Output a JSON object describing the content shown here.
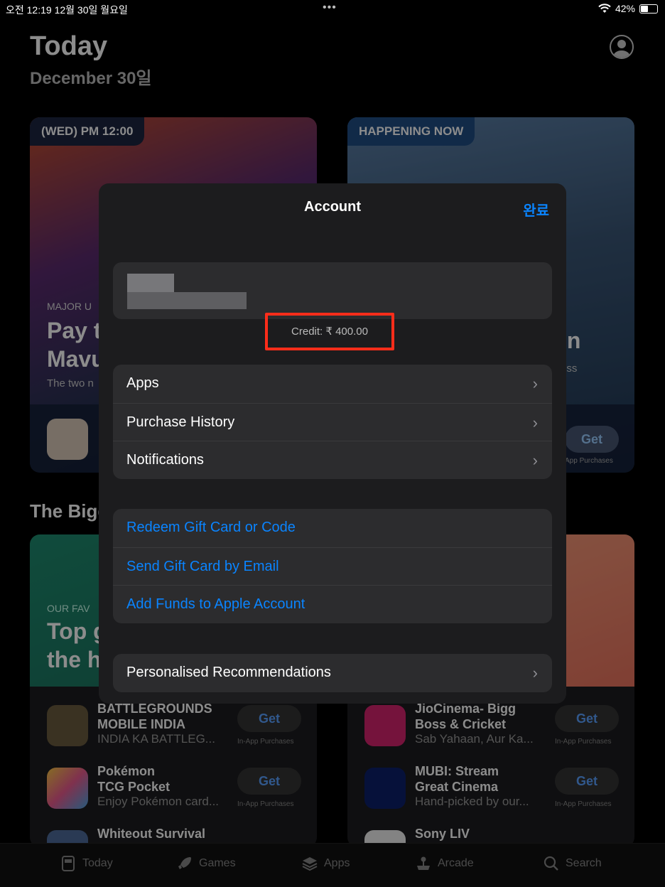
{
  "status_bar": {
    "time_date": "오전 12:19   12월 30일 월요일",
    "dots": "•••",
    "battery": "42%"
  },
  "background": {
    "title": "Today",
    "date": "December 30일",
    "card1": {
      "tag": "(WED) PM 12:00",
      "sub": "MAJOR U",
      "big_line1": "Pay t",
      "big_line2": "Mavu",
      "desc": "The two n"
    },
    "card2": {
      "tag": "HAPPENING NOW",
      "big_right": "in",
      "sub_right": "ess",
      "get": "Get",
      "iap": "App Purchases"
    },
    "section_title": "The Bigg",
    "card3": {
      "sub": "OUR FAV",
      "big_line1": "Top g",
      "big_line2": "the h"
    },
    "apps_left": [
      {
        "name_line1": "BATTLEGROUNDS",
        "name_line2": "MOBILE INDIA",
        "desc": "INDIA KA BATTLEG...",
        "get": "Get",
        "iap": "In-App Purchases"
      },
      {
        "name_line1": "Pokémon",
        "name_line2": "TCG Pocket",
        "desc": "Enjoy Pokémon card...",
        "get": "Get",
        "iap": "In-App Purchases"
      },
      {
        "name_line1": "Whiteout Survival",
        "name_line2": "",
        "desc": "",
        "get": "",
        "iap": ""
      }
    ],
    "apps_right": [
      {
        "name_line1": "JioCinema- Bigg",
        "name_line2": "Boss & Cricket",
        "desc": "Sab Yahaan, Aur Ka...",
        "get": "Get",
        "iap": "In-App Purchases"
      },
      {
        "name_line1": "MUBI: Stream",
        "name_line2": "Great Cinema",
        "desc": "Hand-picked by our...",
        "get": "Get",
        "iap": "In-App Purchases"
      },
      {
        "name_line1": "Sony LIV",
        "name_line2": "",
        "desc": "",
        "get": "",
        "iap": ""
      }
    ]
  },
  "tab_bar": {
    "tabs": [
      "Today",
      "Games",
      "Apps",
      "Arcade",
      "Search"
    ]
  },
  "modal": {
    "title": "Account",
    "done": "완료",
    "credit": "Credit: ₹ 400.00",
    "group1": [
      "Apps",
      "Purchase History",
      "Notifications"
    ],
    "group2": [
      "Redeem Gift Card or Code",
      "Send Gift Card by Email",
      "Add Funds to Apple Account"
    ],
    "group3": [
      "Personalised Recommendations"
    ],
    "chevron": "›"
  },
  "colors": {
    "accent": "#0a84ff",
    "highlight_box": "#ff2d1a",
    "modal_bg": "#1c1c1e",
    "row_bg": "#2c2c2e"
  }
}
